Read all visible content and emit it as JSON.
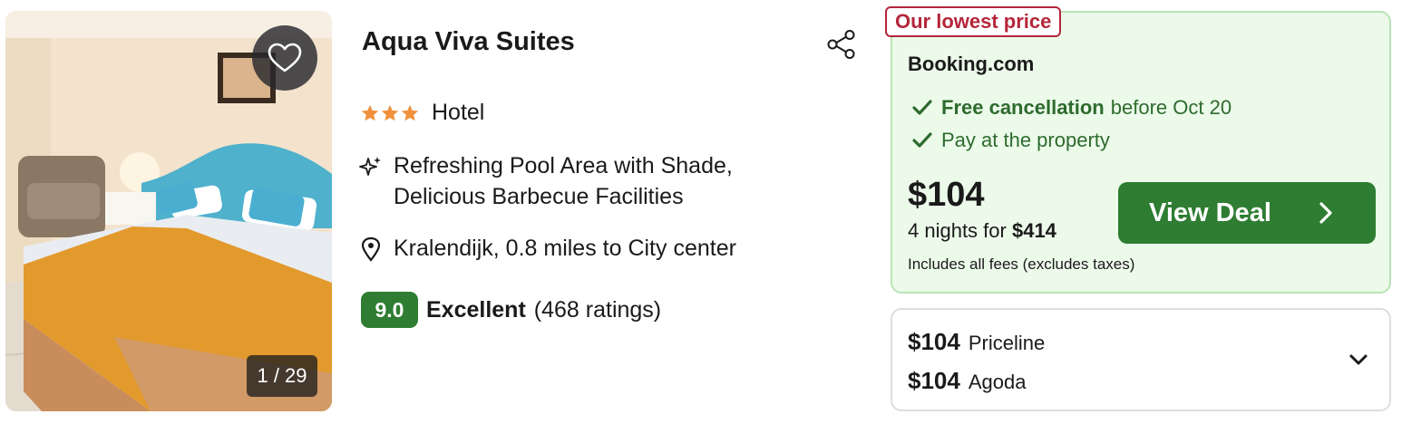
{
  "listing": {
    "photo": {
      "counter": "1 / 29"
    },
    "title": "Aqua Viva Suites",
    "stars": 3,
    "type": "Hotel",
    "feature": "Refreshing Pool Area with Shade, Delicious Barbecue Facilities",
    "location": "Kralendijk, 0.8 miles to City center",
    "rating": {
      "score": "9.0",
      "word": "Excellent",
      "count": "(468 ratings)"
    }
  },
  "deal": {
    "badge": "Our lowest price",
    "provider": "Booking.com",
    "perk1_bold": "Free cancellation",
    "perk1_rest": "before Oct 20",
    "perk2": "Pay at the property",
    "price": "$104",
    "nights_prefix": "4 nights for",
    "nights_total": "$414",
    "fees": "Includes all fees (excludes taxes)",
    "button": "View Deal"
  },
  "other_prices": [
    {
      "price": "$104",
      "provider": "Priceline"
    },
    {
      "price": "$104",
      "provider": "Agoda"
    }
  ],
  "icons": {
    "favorite": "heart-icon",
    "share": "share-icon",
    "feature": "sparkle-icon",
    "location": "map-pin-icon",
    "check": "check-icon",
    "expand": "chevron-down-icon",
    "deal_arrow": "chevron-right-icon"
  },
  "colors": {
    "accent_green": "#2e7d32",
    "deal_bg": "#ecfaea",
    "lowest_badge": "#b5263a",
    "star": "#f0913c"
  }
}
